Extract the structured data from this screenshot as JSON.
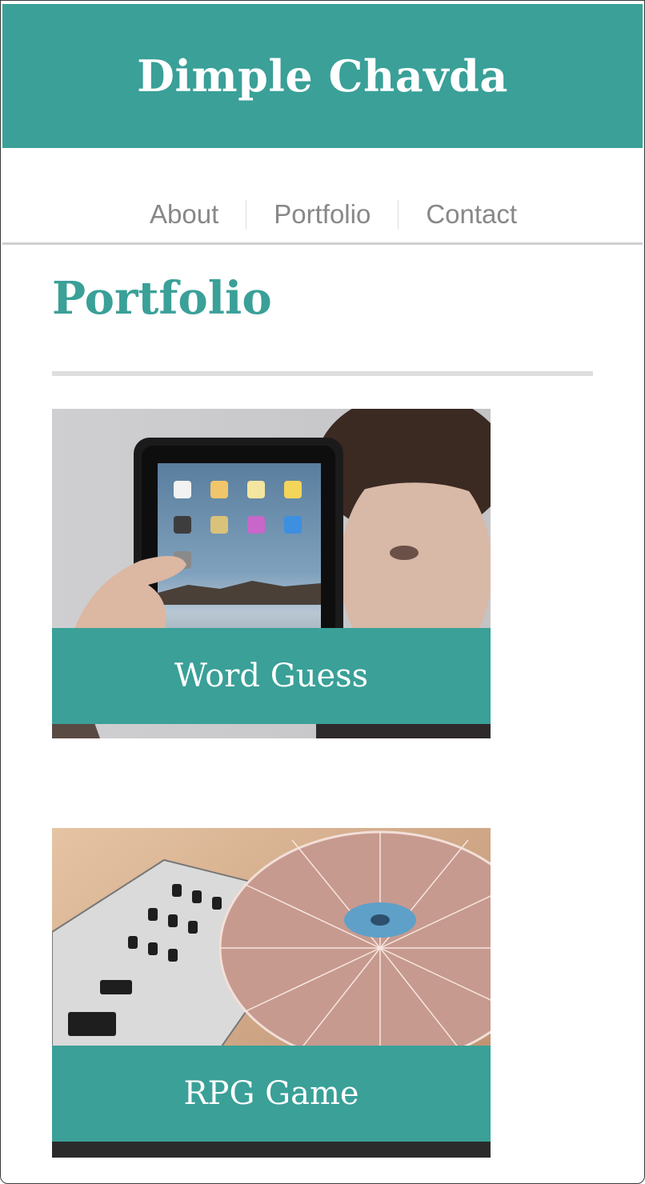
{
  "site": {
    "title": "Dimple Chavda"
  },
  "nav": {
    "items": [
      {
        "label": "About"
      },
      {
        "label": "Portfolio"
      },
      {
        "label": "Contact"
      }
    ]
  },
  "page": {
    "heading": "Portfolio"
  },
  "portfolio": {
    "items": [
      {
        "title": "Word Guess",
        "image": "person-holding-tablet-photo"
      },
      {
        "title": "RPG Game",
        "image": "dj-turntable-photo"
      }
    ]
  },
  "colors": {
    "accent": "#3aa098",
    "nav_text": "#888888",
    "divider": "#dedede"
  }
}
